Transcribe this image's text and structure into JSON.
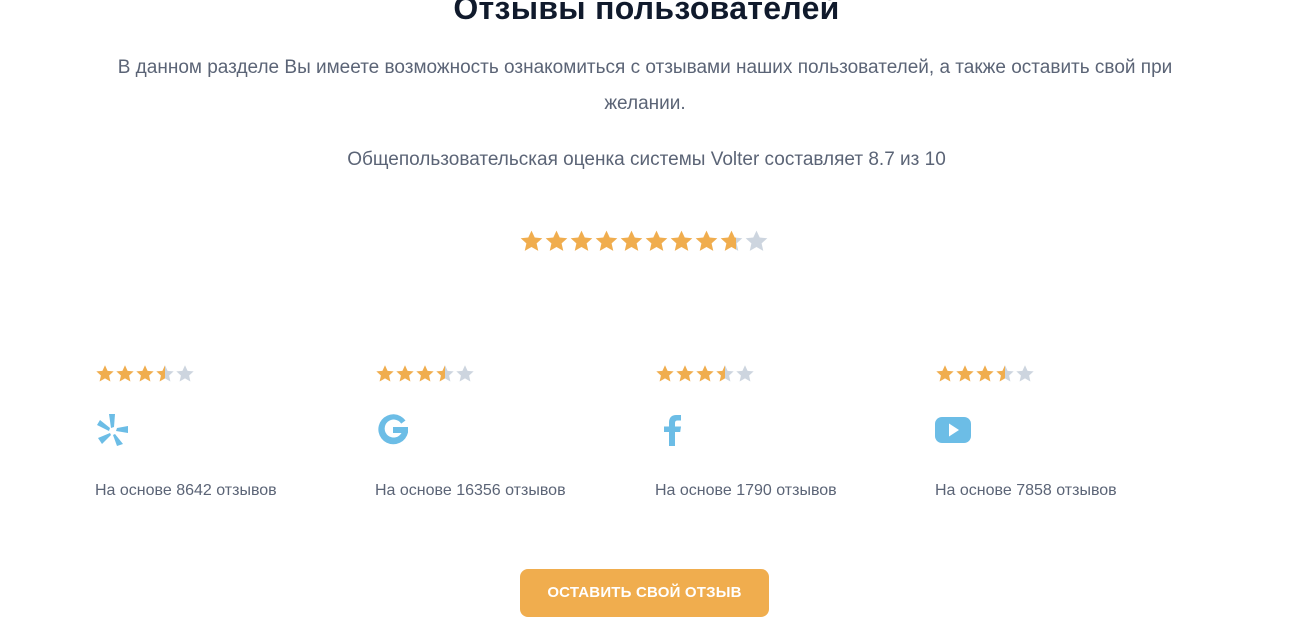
{
  "section": {
    "title": "Отзывы пользователей",
    "subtitle": "В данном разделе Вы имеете возможность ознакомиться с отзывами наших пользователей, а также оставить свой при желании.",
    "overall_text": "Общепользовательская оценка системы Volter составляет 8.7 из 10",
    "overall_rating": 8.7,
    "overall_max": 10
  },
  "colors": {
    "star_filled": "#f0ad4e",
    "star_empty": "#cdd5df",
    "icon_blue": "#6cbde6",
    "button_bg": "#f0ad4e"
  },
  "platforms": [
    {
      "icon": "yelp-icon",
      "rating": 3.5,
      "max": 5,
      "based_text": "На основе 8642 отзывов"
    },
    {
      "icon": "google-icon",
      "rating": 3.5,
      "max": 5,
      "based_text": "На основе 16356 отзывов"
    },
    {
      "icon": "facebook-icon",
      "rating": 3.5,
      "max": 5,
      "based_text": "На основе 1790 отзывов"
    },
    {
      "icon": "youtube-icon",
      "rating": 3.5,
      "max": 5,
      "based_text": "На основе 7858 отзывов"
    }
  ],
  "cta": {
    "label": "ОСТАВИТЬ СВОЙ ОТЗЫВ"
  }
}
